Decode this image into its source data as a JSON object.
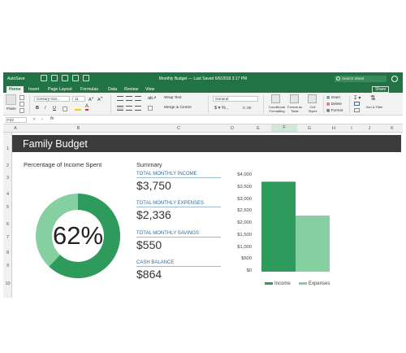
{
  "titlebar": {
    "autosave": "AutoSave",
    "doc_title": "Monthly Budget — Last Saved 6/6/2018 3:17 PM",
    "search_placeholder": "Search Sheet"
  },
  "tabs": [
    "Home",
    "Insert",
    "Page Layout",
    "Formulas",
    "Data",
    "Review",
    "View"
  ],
  "share_label": "Share",
  "ribbon": {
    "paste": "Paste",
    "font_name": "Century Got...",
    "font_size": "11",
    "wrap_text": "Wrap Text",
    "merge_center": "Merge & Centre",
    "number_format": "General",
    "conditional_formatting": "Conditional Formatting",
    "format_as_table": "Format as Table",
    "cell_styles": "Cell Styles",
    "insert": "Insert",
    "delete": "Delete",
    "format": "Format",
    "sort_filter": "Sort & Filter"
  },
  "formula_bar": {
    "name_box": "F22",
    "fx": "fx"
  },
  "columns": [
    "A",
    "B",
    "C",
    "D",
    "E",
    "F",
    "G",
    "H",
    "I",
    "J",
    "K"
  ],
  "rows": [
    "1",
    "2",
    "3",
    "4",
    "5",
    "6",
    "7",
    "8",
    "9",
    "10"
  ],
  "sheet": {
    "title": "Family Budget",
    "percent_label": "Percentage of Income Spent",
    "percent_value": "62%",
    "percent_fraction": 0.62,
    "summary_title": "Summary",
    "summary": [
      {
        "label": "TOTAL MONTHLY INCOME",
        "value": "$3,750"
      },
      {
        "label": "TOTAL MONTHLY EXPENSES",
        "value": "$2,336"
      },
      {
        "label": "TOTAL MONTHLY SAVINGS",
        "value": "$550"
      },
      {
        "label": "CASH BALANCE",
        "value": "$864"
      }
    ]
  },
  "colors": {
    "excel_green": "#217346",
    "banner": "#3b3b3b",
    "income": "#2e9a5b",
    "expenses": "#86cfa0",
    "donut_light": "#86cfa0",
    "donut_dark": "#2e9a5b",
    "summary_label": "#2c6fa0"
  },
  "chart_data": {
    "type": "bar",
    "categories": [
      "Income",
      "Expenses"
    ],
    "values": [
      3750,
      2336
    ],
    "ylim": [
      0,
      4000
    ],
    "yticks": [
      "$0",
      "$500",
      "$1,000",
      "$1,500",
      "$2,000",
      "$2,500",
      "$3,000",
      "$3,500",
      "$4,000"
    ],
    "legend": [
      "Income",
      "Expenses"
    ],
    "legend_position": "bottom"
  }
}
